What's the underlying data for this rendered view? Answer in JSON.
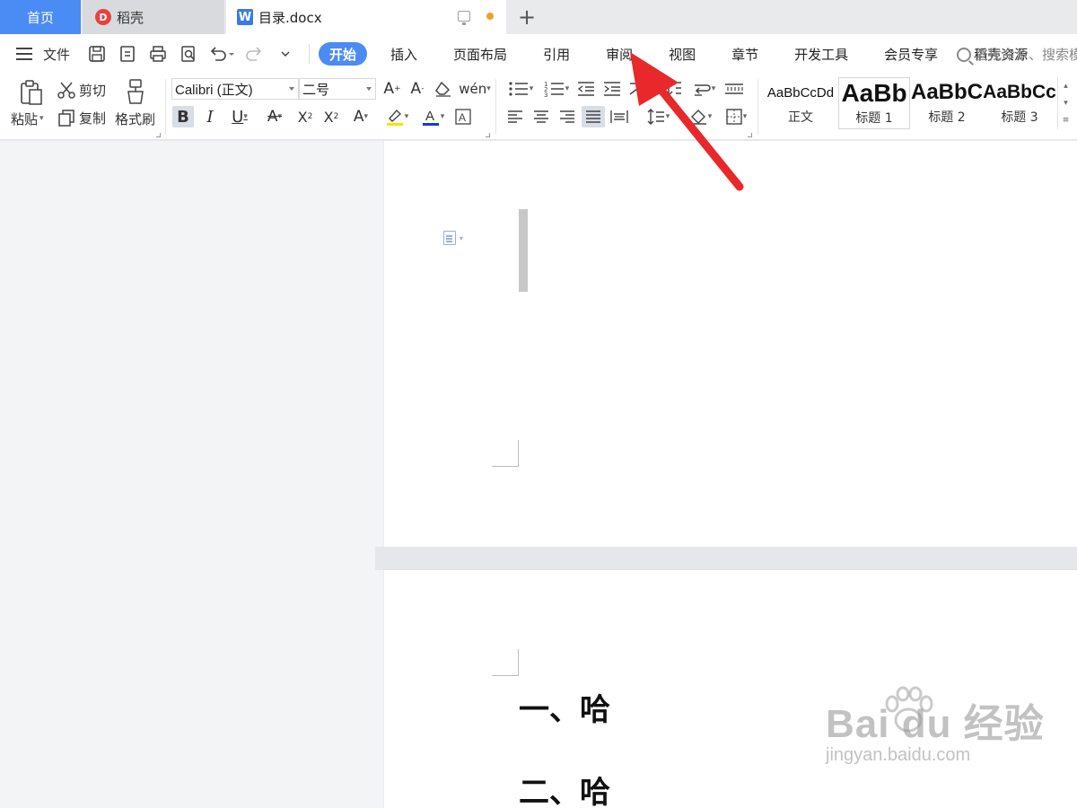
{
  "tabs": {
    "home": "首页",
    "daoke": "稻壳",
    "document": "目录.docx"
  },
  "menu": {
    "file": "文件",
    "tabs": [
      "开始",
      "插入",
      "页面布局",
      "引用",
      "审阅",
      "视图",
      "章节",
      "开发工具",
      "会员专享",
      "稻壳资源"
    ],
    "active_tab": "开始",
    "search_placeholder": "查找命令、搜索模板"
  },
  "ribbon": {
    "paste": "粘贴",
    "cut": "剪切",
    "copy": "复制",
    "format_painter": "格式刷",
    "font_name": "Calibri (正文)",
    "font_size": "二号",
    "styles": [
      {
        "sample": "AaBbCcDd",
        "name": "正文"
      },
      {
        "sample": "AaBb",
        "name": "标题 1"
      },
      {
        "sample": "AaBbC",
        "name": "标题 2"
      },
      {
        "sample": "AaBbCc",
        "name": "标题 3"
      }
    ]
  },
  "document": {
    "headings": [
      "一、哈",
      "二、哈"
    ]
  },
  "watermark": {
    "main": "Bai du 经验",
    "sub": "jingyan.baidu.com"
  },
  "colors": {
    "accent": "#4b8bf4",
    "arrow": "#e8282b"
  }
}
